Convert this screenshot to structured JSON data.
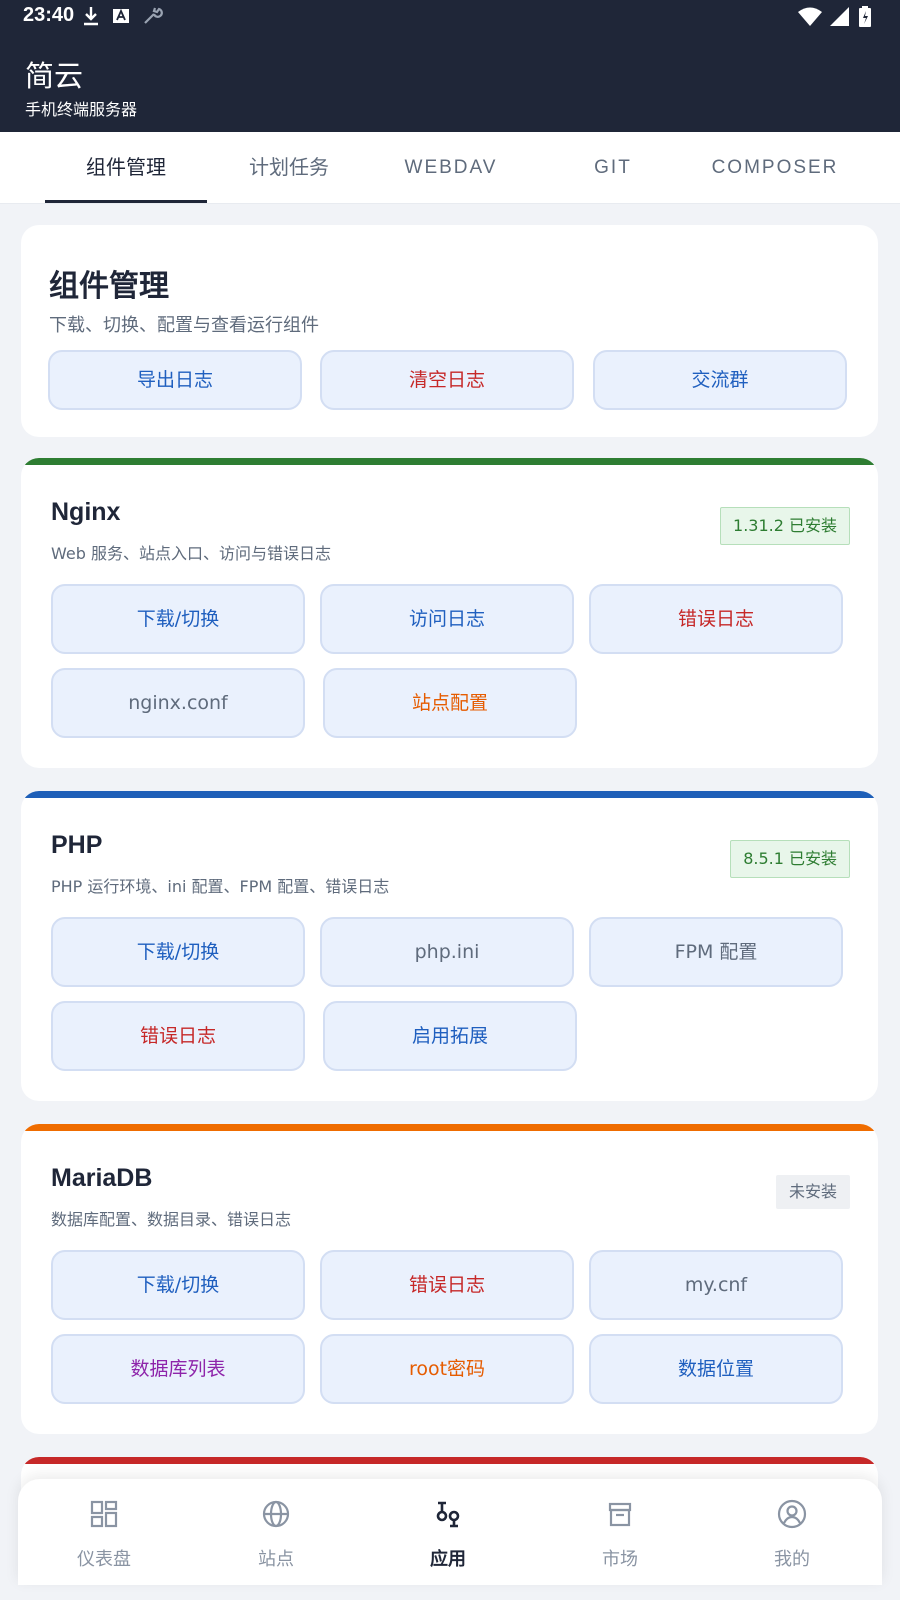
{
  "status_bar": {
    "time": "23:40"
  },
  "app": {
    "title": "简云",
    "subtitle": "手机终端服务器"
  },
  "tabs": [
    {
      "label": "组件管理",
      "active": true
    },
    {
      "label": "计划任务",
      "active": false
    },
    {
      "label": "WEBDAV",
      "active": false
    },
    {
      "label": "GIT",
      "active": false
    },
    {
      "label": "COMPOSER",
      "active": false
    }
  ],
  "header_card": {
    "title": "组件管理",
    "description": "下载、切换、配置与查看运行组件",
    "buttons": [
      "导出日志",
      "清空日志",
      "交流群"
    ]
  },
  "components": [
    {
      "name": "Nginx",
      "description": "Web 服务、站点入口、访问与错误日志",
      "badge": "1.31.2 已安装",
      "accent": "#2e7d32",
      "buttons": [
        "下载/切换",
        "访问日志",
        "错误日志",
        "nginx.conf",
        "站点配置"
      ]
    },
    {
      "name": "PHP",
      "description": "PHP 运行环境、ini 配置、FPM 配置、错误日志",
      "badge": "8.5.1 已安装",
      "accent": "#1e5fb8",
      "buttons": [
        "下载/切换",
        "php.ini",
        "FPM 配置",
        "错误日志",
        "启用拓展"
      ]
    },
    {
      "name": "MariaDB",
      "description": "数据库配置、数据目录、错误日志",
      "badge": "未安装",
      "accent": "#ef6c00",
      "buttons": [
        "下载/切换",
        "错误日志",
        "my.cnf",
        "数据库列表",
        "root密码",
        "数据位置"
      ]
    },
    {
      "accent": "#c62828"
    }
  ],
  "bottom_nav": [
    {
      "label": "仪表盘",
      "icon": "dashboard-icon",
      "active": false
    },
    {
      "label": "站点",
      "icon": "globe-icon",
      "active": false
    },
    {
      "label": "应用",
      "icon": "apps-icon",
      "active": true
    },
    {
      "label": "市场",
      "icon": "store-icon",
      "active": false
    },
    {
      "label": "我的",
      "icon": "profile-icon",
      "active": false
    }
  ]
}
